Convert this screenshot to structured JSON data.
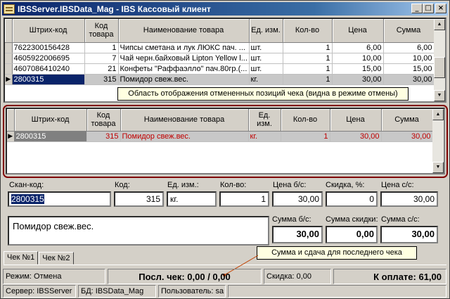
{
  "window": {
    "title": "IBSServer.IBSData_Mag - IBS Кассовый клиент",
    "buttons": {
      "minimize": "_",
      "maximize": "□",
      "close": "×"
    }
  },
  "receipt_grid": {
    "columns": [
      "Штрих-код",
      "Код товара",
      "Наименование товара",
      "Ед. изм.",
      "Кол-во",
      "Цена",
      "Сумма"
    ],
    "rows": [
      {
        "barcode": "7622300156428",
        "code": "1",
        "name": "Чипсы сметана и лук ЛЮКС пач. ...",
        "unit": "шт.",
        "qty": "1",
        "price": "6,00",
        "sum": "6,00"
      },
      {
        "barcode": "4605922006695",
        "code": "7",
        "name": "Чай черн.байховый Lipton Yellow l...",
        "unit": "шт.",
        "qty": "1",
        "price": "10,00",
        "sum": "10,00"
      },
      {
        "barcode": "4607086410240",
        "code": "21",
        "name": "Конфеты \"Раффаэлло\" пач.80гр.(...",
        "unit": "шт.",
        "qty": "1",
        "price": "15,00",
        "sum": "15,00"
      },
      {
        "barcode": "2800315",
        "code": "315",
        "name": "Помидор свеж.вес.",
        "unit": "кг.",
        "qty": "1",
        "price": "30,00",
        "sum": "30,00"
      }
    ]
  },
  "cancel_grid": {
    "columns": [
      "Штрих-код",
      "Код товара",
      "Наименование товара",
      "Ед. изм.",
      "Кол-во",
      "Цена",
      "Сумма"
    ],
    "rows": [
      {
        "barcode": "2800315",
        "code": "315",
        "name": "Помидор свеж.вес.",
        "unit": "кг.",
        "qty": "1",
        "price": "30,00",
        "sum": "30,00"
      }
    ]
  },
  "callouts": {
    "cancel_area": "Область отображения отмененных позиций чека (видна в режиме отмены)",
    "last_check": "Сумма и сдача для последнего чека"
  },
  "form": {
    "scan_label": "Скан-код:",
    "scan_value": "2800315",
    "code_label": "Код:",
    "code_value": "315",
    "unit_label": "Ед. изм.:",
    "unit_value": "кг.",
    "qty_label": "Кол-во:",
    "qty_value": "1",
    "price_nodisc_label": "Цена б/с:",
    "price_nodisc_value": "30,00",
    "discount_pct_label": "Скидка, %:",
    "discount_pct_value": "0",
    "price_disc_label": "Цена с/с:",
    "price_disc_value": "30,00",
    "product_name": "Помидор свеж.вес.",
    "sum_nodisc_label": "Сумма б/с:",
    "sum_nodisc_value": "30,00",
    "sum_discount_label": "Сумма скидки:",
    "sum_discount_value": "0,00",
    "sum_disc_label": "Сумма с/с:",
    "sum_disc_value": "30,00"
  },
  "tabs": [
    "Чек №1",
    "Чек №2"
  ],
  "status": {
    "mode": "Режим: Отмена",
    "last_check": "Посл. чек: 0,00 / 0,00",
    "discount": "Скидка: 0,00",
    "to_pay": "К оплате: 61,00",
    "server": "Сервер: IBSServer",
    "db": "БД: IBSData_Mag",
    "user": "Пользователь: sa"
  },
  "colors": {
    "title_bar": "#0a246a",
    "cancel_frame": "#800000",
    "cancel_text": "#c00000",
    "selection": "#0a246a"
  }
}
